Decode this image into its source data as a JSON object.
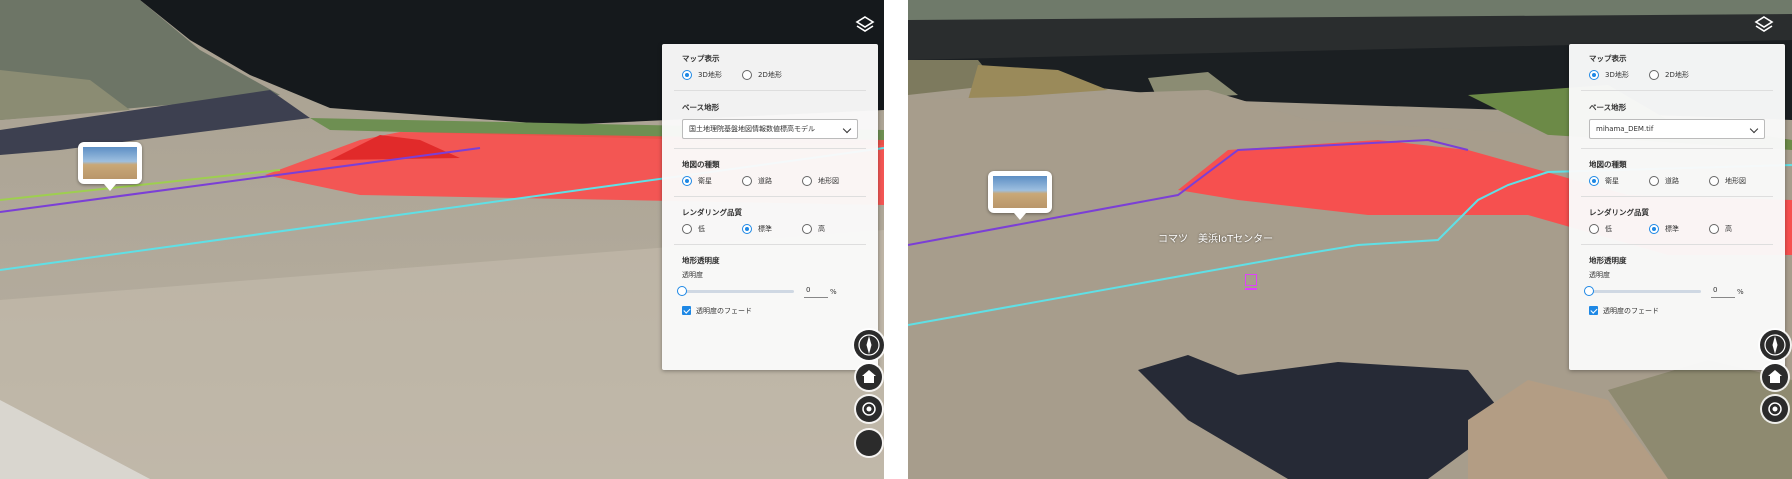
{
  "panels": [
    {
      "map_display": {
        "title": "マップ表示",
        "options": [
          {
            "label": "3D地形",
            "selected": true
          },
          {
            "label": "2D地形",
            "selected": false
          }
        ]
      },
      "base_terrain": {
        "title": "ベース地形",
        "value": "国土地理院基盤地図情報数値標高モデル"
      },
      "map_type": {
        "title": "地図の種類",
        "options": [
          {
            "label": "衛星",
            "selected": true
          },
          {
            "label": "道路",
            "selected": false
          },
          {
            "label": "地形図",
            "selected": false
          }
        ]
      },
      "rendering_quality": {
        "title": "レンダリング品質",
        "options": [
          {
            "label": "低",
            "selected": false
          },
          {
            "label": "標準",
            "selected": true
          },
          {
            "label": "高",
            "selected": false
          }
        ]
      },
      "terrain_transparency": {
        "title": "地形透明度",
        "sub_label": "透明度",
        "value": "0",
        "unit": "%",
        "level": 0,
        "fade_label": "透明度のフェード",
        "fade_checked": true
      }
    },
    {
      "map_display": {
        "title": "マップ表示",
        "options": [
          {
            "label": "3D地形",
            "selected": true
          },
          {
            "label": "2D地形",
            "selected": false
          }
        ]
      },
      "base_terrain": {
        "title": "ベース地形",
        "value": "mihama_DEM.tif"
      },
      "map_type": {
        "title": "地図の種類",
        "options": [
          {
            "label": "衛星",
            "selected": true
          },
          {
            "label": "道路",
            "selected": false
          },
          {
            "label": "地形図",
            "selected": false
          }
        ]
      },
      "rendering_quality": {
        "title": "レンダリング品質",
        "options": [
          {
            "label": "低",
            "selected": false
          },
          {
            "label": "標準",
            "selected": true
          },
          {
            "label": "高",
            "selected": false
          }
        ]
      },
      "terrain_transparency": {
        "title": "地形透明度",
        "sub_label": "透明度",
        "value": "0",
        "unit": "%",
        "level": 0,
        "fade_label": "透明度のフェード",
        "fade_checked": true
      }
    }
  ],
  "map_labels": {
    "right_place": "コマツ　美浜IoTセンター"
  },
  "icons": {
    "layers": "layers-icon",
    "compass": "compass-icon",
    "home": "home-icon",
    "locate": "locate-icon",
    "photo": "photo-marker-icon",
    "pin": "location-pin-icon"
  },
  "colors": {
    "accent": "#1e88e5",
    "polygon": "#ff3b3b",
    "line_purple": "#7b3fd6",
    "line_cyan": "#5fe0e6"
  }
}
